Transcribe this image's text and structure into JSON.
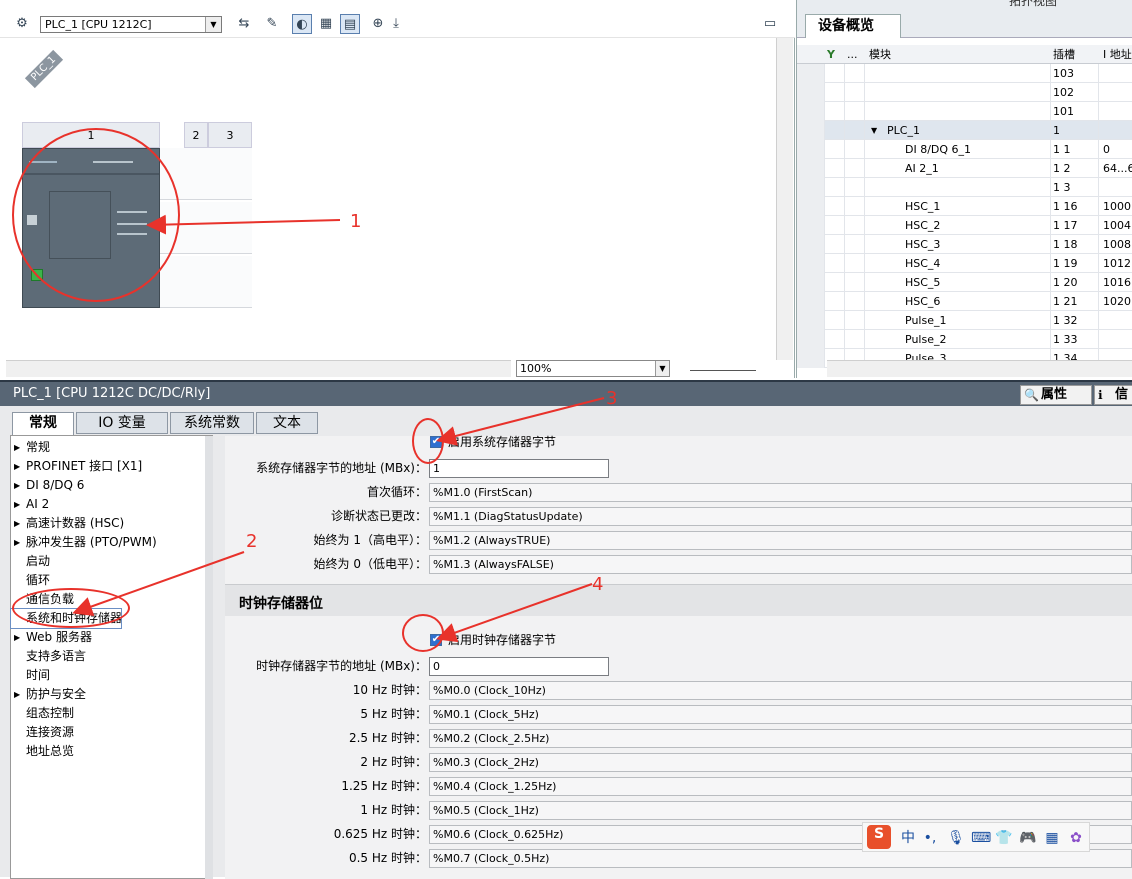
{
  "device_view": {
    "device_select": "PLC_1 [CPU 1212C]",
    "plc_tag": "PLC_1",
    "rack_slots": [
      "1",
      "2",
      "3"
    ],
    "zoom": "100%"
  },
  "overview": {
    "top_tab_partial": "拓扑视图",
    "tab": "设备概览",
    "columns": [
      "...",
      "模块",
      "插槽",
      "I 地址"
    ],
    "rows": [
      {
        "module": "",
        "slot": "103",
        "addr": ""
      },
      {
        "module": "",
        "slot": "102",
        "addr": ""
      },
      {
        "module": "",
        "slot": "101",
        "addr": ""
      },
      {
        "module": "PLC_1",
        "slot": "1",
        "addr": ""
      },
      {
        "module": "DI 8/DQ 6_1",
        "slot": "1 1",
        "addr": "0"
      },
      {
        "module": "AI 2_1",
        "slot": "1 2",
        "addr": "64...6"
      },
      {
        "module": "",
        "slot": "1 3",
        "addr": ""
      },
      {
        "module": "HSC_1",
        "slot": "1 16",
        "addr": "1000"
      },
      {
        "module": "HSC_2",
        "slot": "1 17",
        "addr": "1004"
      },
      {
        "module": "HSC_3",
        "slot": "1 18",
        "addr": "1008"
      },
      {
        "module": "HSC_4",
        "slot": "1 19",
        "addr": "1012"
      },
      {
        "module": "HSC_5",
        "slot": "1 20",
        "addr": "1016"
      },
      {
        "module": "HSC_6",
        "slot": "1 21",
        "addr": "1020"
      },
      {
        "module": "Pulse_1",
        "slot": "1 32",
        "addr": ""
      },
      {
        "module": "Pulse_2",
        "slot": "1 33",
        "addr": ""
      },
      {
        "module": "Pulse_3",
        "slot": "1 34",
        "addr": ""
      }
    ]
  },
  "properties": {
    "title": "PLC_1 [CPU 1212C DC/DC/Rly]",
    "tab_properties": "属性",
    "tab_info": "信",
    "tabs": [
      "常规",
      "IO 变量",
      "系统常数",
      "文本"
    ],
    "nav": [
      {
        "label": "常规",
        "expand": true
      },
      {
        "label": "PROFINET 接口 [X1]",
        "expand": true
      },
      {
        "label": "DI 8/DQ 6",
        "expand": true
      },
      {
        "label": "AI 2",
        "expand": true
      },
      {
        "label": "高速计数器 (HSC)",
        "expand": true
      },
      {
        "label": "脉冲发生器 (PTO/PWM)",
        "expand": true
      },
      {
        "label": "启动",
        "expand": false
      },
      {
        "label": "循环",
        "expand": false
      },
      {
        "label": "通信负载",
        "expand": false
      },
      {
        "label": "系统和时钟存储器",
        "expand": false
      },
      {
        "label": "Web 服务器",
        "expand": true
      },
      {
        "label": "支持多语言",
        "expand": false
      },
      {
        "label": "时间",
        "expand": false
      },
      {
        "label": "防护与安全",
        "expand": true
      },
      {
        "label": "组态控制",
        "expand": false
      },
      {
        "label": "连接资源",
        "expand": false
      },
      {
        "label": "地址总览",
        "expand": false
      }
    ],
    "system": {
      "enable_label": "启用系统存储器字节",
      "address_label": "系统存储器字节的地址 (MBx)：",
      "address_value": "1",
      "rows": [
        {
          "label": "首次循环：",
          "value": "%M1.0 (FirstScan)"
        },
        {
          "label": "诊断状态已更改：",
          "value": "%M1.1 (DiagStatusUpdate)"
        },
        {
          "label": "始终为 1（高电平）：",
          "value": "%M1.2 (AlwaysTRUE)"
        },
        {
          "label": "始终为 0（低电平）：",
          "value": "%M1.3 (AlwaysFALSE)"
        }
      ]
    },
    "clock": {
      "section_title": "时钟存储器位",
      "enable_label": "启用时钟存储器字节",
      "address_label": "时钟存储器字节的地址 (MBx)：",
      "address_value": "0",
      "rows": [
        {
          "label": "10 Hz 时钟：",
          "value": "%M0.0 (Clock_10Hz)"
        },
        {
          "label": "5 Hz 时钟：",
          "value": "%M0.1 (Clock_5Hz)"
        },
        {
          "label": "2.5 Hz 时钟：",
          "value": "%M0.2 (Clock_2.5Hz)"
        },
        {
          "label": "2 Hz 时钟：",
          "value": "%M0.3 (Clock_2Hz)"
        },
        {
          "label": "1.25 Hz 时钟：",
          "value": "%M0.4 (Clock_1.25Hz)"
        },
        {
          "label": "1 Hz 时钟：",
          "value": "%M0.5 (Clock_1Hz)"
        },
        {
          "label": "0.625 Hz 时钟：",
          "value": "%M0.6 (Clock_0.625Hz)"
        },
        {
          "label": "0.5 Hz 时钟：",
          "value": "%M0.7 (Clock_0.5Hz)"
        }
      ]
    }
  },
  "annotations": [
    "1",
    "2",
    "3",
    "4"
  ],
  "colors": {
    "annotation": "#e8322b",
    "title_bar": "#586675",
    "checkbox": "#2f6fcf"
  },
  "ime": {
    "zh": "中"
  }
}
